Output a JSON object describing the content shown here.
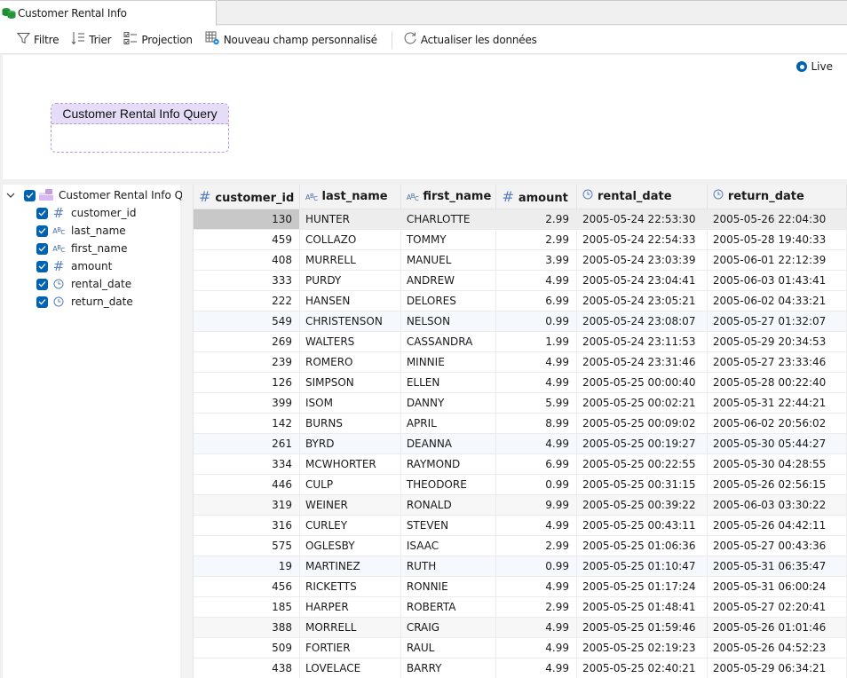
{
  "tab": {
    "title": "Customer Rental Info",
    "icon": "database-tables-icon"
  },
  "toolbar": {
    "filter_label": "Filtre",
    "sort_label": "Trier",
    "projection_label": "Projection",
    "custom_field_label": "Nouveau champ personnalisé",
    "refresh_label": "Actualiser les données"
  },
  "canvas": {
    "live_label": "Live",
    "live_selected": true,
    "query_node_title": "Customer Rental Info Query"
  },
  "tree": {
    "root_label": "Customer Rental Info Quer",
    "root_checked": true,
    "fields": [
      {
        "name": "customer_id",
        "type": "number",
        "checked": true
      },
      {
        "name": "last_name",
        "type": "text",
        "checked": true
      },
      {
        "name": "first_name",
        "type": "text",
        "checked": true
      },
      {
        "name": "amount",
        "type": "number",
        "checked": true
      },
      {
        "name": "rental_date",
        "type": "datetime",
        "checked": true
      },
      {
        "name": "return_date",
        "type": "datetime",
        "checked": true
      }
    ]
  },
  "grid": {
    "columns": [
      {
        "name": "customer_id",
        "type": "number"
      },
      {
        "name": "last_name",
        "type": "text"
      },
      {
        "name": "first_name",
        "type": "text"
      },
      {
        "name": "amount",
        "type": "number"
      },
      {
        "name": "rental_date",
        "type": "datetime"
      },
      {
        "name": "return_date",
        "type": "datetime"
      }
    ],
    "selected_row": 0,
    "rows": [
      [
        "130",
        "HUNTER",
        "CHARLOTTE",
        "2.99",
        "2005-05-24 22:53:30",
        "2005-05-26 22:04:30"
      ],
      [
        "459",
        "COLLAZO",
        "TOMMY",
        "2.99",
        "2005-05-24 22:54:33",
        "2005-05-28 19:40:33"
      ],
      [
        "408",
        "MURRELL",
        "MANUEL",
        "3.99",
        "2005-05-24 23:03:39",
        "2005-06-01 22:12:39"
      ],
      [
        "333",
        "PURDY",
        "ANDREW",
        "4.99",
        "2005-05-24 23:04:41",
        "2005-06-03 01:43:41"
      ],
      [
        "222",
        "HANSEN",
        "DELORES",
        "6.99",
        "2005-05-24 23:05:21",
        "2005-06-02 04:33:21"
      ],
      [
        "549",
        "CHRISTENSON",
        "NELSON",
        "0.99",
        "2005-05-24 23:08:07",
        "2005-05-27 01:32:07"
      ],
      [
        "269",
        "WALTERS",
        "CASSANDRA",
        "1.99",
        "2005-05-24 23:11:53",
        "2005-05-29 20:34:53"
      ],
      [
        "239",
        "ROMERO",
        "MINNIE",
        "4.99",
        "2005-05-24 23:31:46",
        "2005-05-27 23:33:46"
      ],
      [
        "126",
        "SIMPSON",
        "ELLEN",
        "4.99",
        "2005-05-25 00:00:40",
        "2005-05-28 00:22:40"
      ],
      [
        "399",
        "ISOM",
        "DANNY",
        "5.99",
        "2005-05-25 00:02:21",
        "2005-05-31 22:44:21"
      ],
      [
        "142",
        "BURNS",
        "APRIL",
        "8.99",
        "2005-05-25 00:09:02",
        "2005-06-02 20:56:02"
      ],
      [
        "261",
        "BYRD",
        "DEANNA",
        "4.99",
        "2005-05-25 00:19:27",
        "2005-05-30 05:44:27"
      ],
      [
        "334",
        "MCWHORTER",
        "RAYMOND",
        "6.99",
        "2005-05-25 00:22:55",
        "2005-05-30 04:28:55"
      ],
      [
        "446",
        "CULP",
        "THEODORE",
        "0.99",
        "2005-05-25 00:31:15",
        "2005-05-26 02:56:15"
      ],
      [
        "319",
        "WEINER",
        "RONALD",
        "9.99",
        "2005-05-25 00:39:22",
        "2005-06-03 03:30:22"
      ],
      [
        "316",
        "CURLEY",
        "STEVEN",
        "4.99",
        "2005-05-25 00:43:11",
        "2005-05-26 04:42:11"
      ],
      [
        "575",
        "OGLESBY",
        "ISAAC",
        "2.99",
        "2005-05-25 01:06:36",
        "2005-05-27 00:43:36"
      ],
      [
        "19",
        "MARTINEZ",
        "RUTH",
        "0.99",
        "2005-05-25 01:10:47",
        "2005-05-31 06:35:47"
      ],
      [
        "456",
        "RICKETTS",
        "RONNIE",
        "4.99",
        "2005-05-25 01:17:24",
        "2005-05-31 06:00:24"
      ],
      [
        "185",
        "HARPER",
        "ROBERTA",
        "2.99",
        "2005-05-25 01:48:41",
        "2005-05-27 02:20:41"
      ],
      [
        "388",
        "MORRELL",
        "CRAIG",
        "4.99",
        "2005-05-25 01:59:46",
        "2005-05-26 01:01:46"
      ],
      [
        "509",
        "FORTIER",
        "RAUL",
        "4.99",
        "2005-05-25 02:19:23",
        "2005-05-26 04:52:23"
      ],
      [
        "438",
        "LOVELACE",
        "BARRY",
        "4.99",
        "2005-05-25 02:40:21",
        "2005-05-29 06:34:21"
      ]
    ]
  },
  "colors": {
    "accent": "#0063b1",
    "query_node_header": "#e5dcf7",
    "query_node_border": "#b89ad6",
    "selected_cell": "#c8c8c8"
  }
}
